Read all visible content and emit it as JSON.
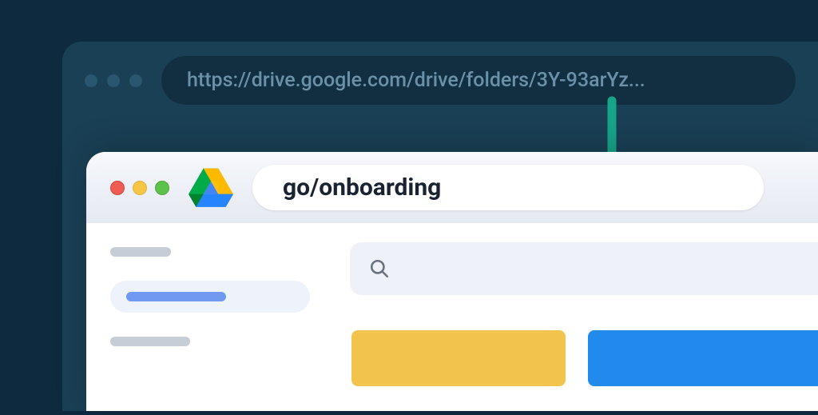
{
  "outer_browser": {
    "url_display": "https://drive.google.com/drive/folders/3Y-93arYz..."
  },
  "inner_browser": {
    "short_url": "go/onboarding"
  },
  "colors": {
    "arrow": "#17a589",
    "tile_yellow": "#f2c44c",
    "tile_blue": "#238aed"
  }
}
